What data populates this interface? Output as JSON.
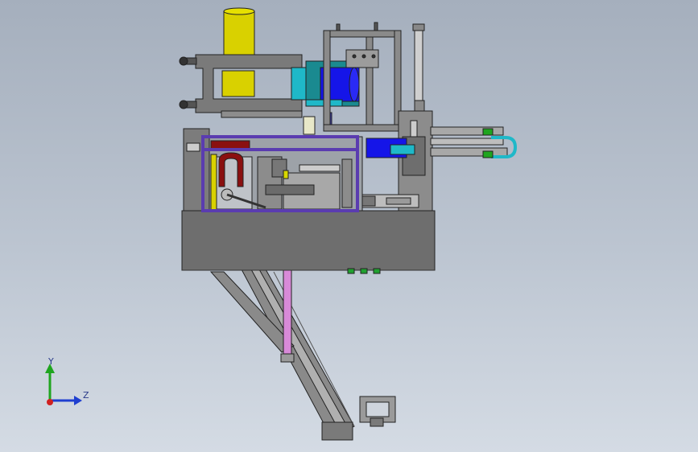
{
  "triad": {
    "y_label": "Y",
    "z_label": "Z",
    "colors": {
      "y": "#1fa51f",
      "z": "#1f3fd0",
      "x": "#d02020"
    }
  },
  "model": {
    "icon": "machine-assembly-icon",
    "colors": {
      "frame": "#6e6e6e",
      "frame_light": "#9a9a9a",
      "cylinder_yellow": "#d9d100",
      "motor_blue": "#1515e8",
      "cyan_block": "#1fb8c8",
      "purple_frame": "#5a3cb0",
      "red_part": "#8a1010",
      "pink_rod": "#d88ad8",
      "green_pegs": "#20a030",
      "outline": "#222222"
    }
  }
}
